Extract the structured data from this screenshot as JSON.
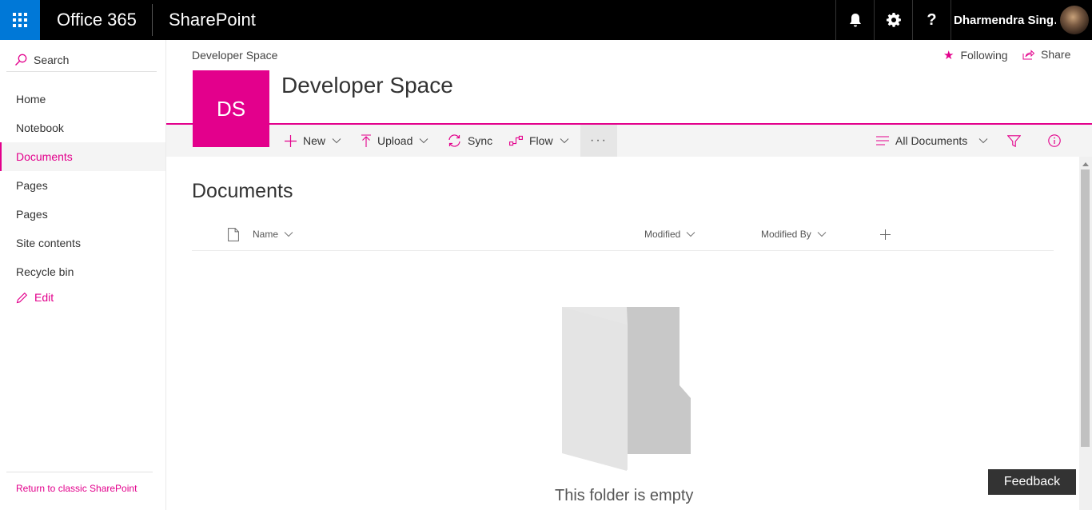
{
  "suite": {
    "brand": "Office 365",
    "app_name": "SharePoint",
    "user_name": "Dharmendra Sing…",
    "accent_color": "#0078d7"
  },
  "leftnav": {
    "search_label": "Search",
    "items": [
      {
        "label": "Home",
        "selected": false
      },
      {
        "label": "Notebook",
        "selected": false
      },
      {
        "label": "Documents",
        "selected": true
      },
      {
        "label": "Pages",
        "selected": false
      },
      {
        "label": "Pages",
        "selected": false
      },
      {
        "label": "Site contents",
        "selected": false
      },
      {
        "label": "Recycle bin",
        "selected": false
      }
    ],
    "edit_label": "Edit",
    "return_label": "Return to classic SharePoint"
  },
  "header": {
    "breadcrumb": "Developer Space",
    "following_label": "Following",
    "share_label": "Share",
    "site_initials": "DS",
    "site_title": "Developer Space",
    "theme_color": "#e3008c"
  },
  "commandbar": {
    "new_label": "New",
    "upload_label": "Upload",
    "sync_label": "Sync",
    "flow_label": "Flow",
    "more_label": "···",
    "view_label": "All Documents"
  },
  "library": {
    "title": "Documents",
    "columns": [
      "Name",
      "Modified",
      "Modified By"
    ],
    "empty_message": "This folder is empty"
  },
  "feedback_label": "Feedback"
}
